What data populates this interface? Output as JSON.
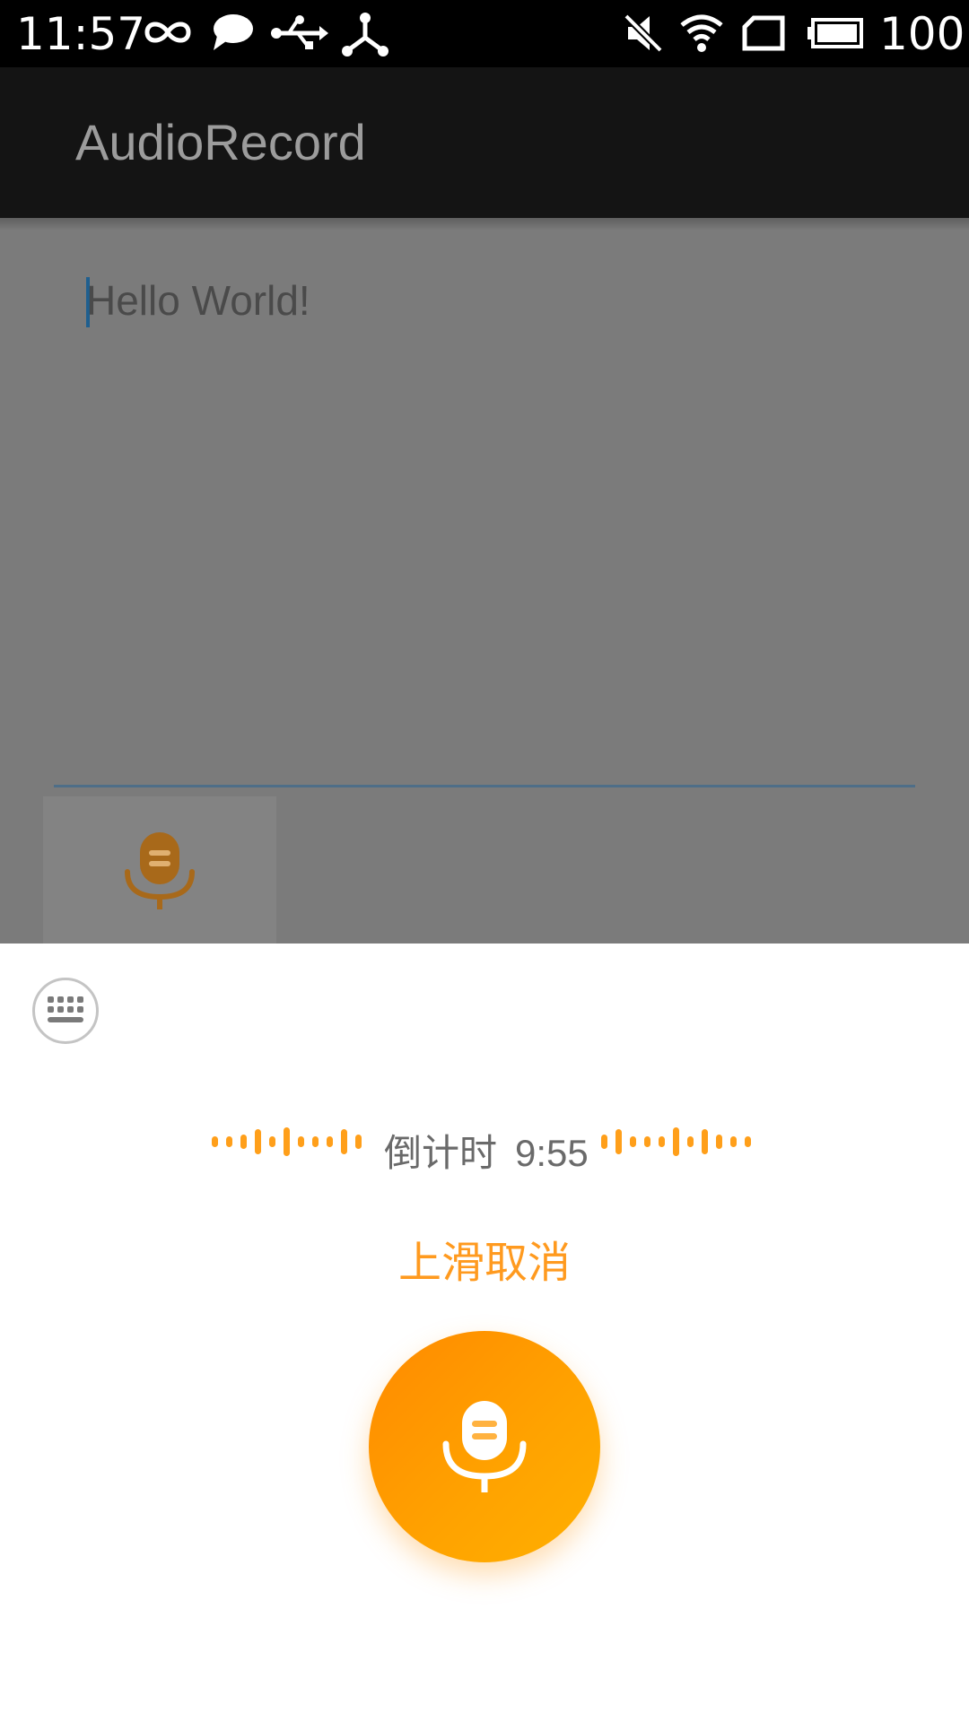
{
  "status_bar": {
    "time": "11:57",
    "battery": "100",
    "icons": [
      "infinity-icon",
      "chat-bubble-icon",
      "usb-icon",
      "tethering-icon",
      "mute-icon",
      "wifi-icon",
      "sim-card-icon",
      "battery-icon"
    ]
  },
  "app_bar": {
    "title": "AudioRecord"
  },
  "content": {
    "text": "Hello World!"
  },
  "recorder": {
    "countdown_label": "倒计时",
    "countdown_time": "9:55",
    "cancel_hint": "上滑取消"
  },
  "colors": {
    "accent": "#FF9A1F",
    "record_button": "#FF9400",
    "dim_overlay": "#7B7B7B",
    "app_bar": "#141414"
  }
}
